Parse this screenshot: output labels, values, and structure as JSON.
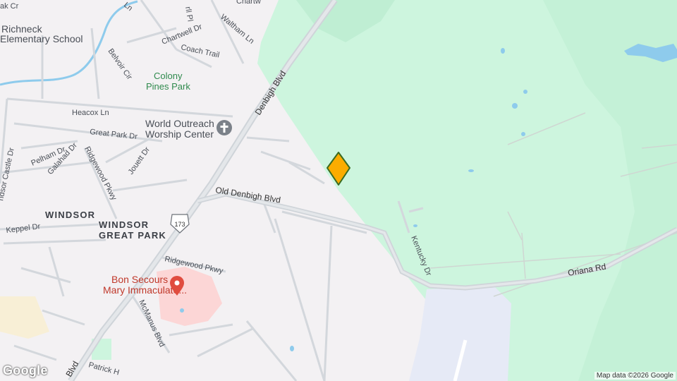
{
  "map": {
    "colors": {
      "land": "#f3f1f3",
      "park": "#cdf5de",
      "park_dark": "#bfeed3",
      "water": "#8ecbec",
      "road_major": "#cfd4d9",
      "road_minor": "#d6d9de",
      "hospital": "#fcd6d6",
      "airport": "#e6eaf6",
      "commercial": "#f8efd6",
      "marker": "#fbac00",
      "marker_stroke": "#3a6b22"
    },
    "labels": {
      "school": [
        "Richneck",
        "Elementary School"
      ],
      "colony_pines": [
        "Colony",
        "Pines Park"
      ],
      "church": [
        "World Outreach",
        "Worship Center"
      ],
      "windsor": "WINDSOR",
      "windsor_great_park": [
        "WINDSOR",
        "GREAT PARK"
      ],
      "hospital": [
        "Bon Secours",
        "Mary Immaculate..."
      ],
      "route_shield": "173"
    },
    "streets": {
      "chartwell_top": "Chartw",
      "waltham": "Waltham Ln",
      "chartwell_dr": "Chartwell Dr",
      "coach_trail": "Coach Trail",
      "belvoir": "Belvoir Cir",
      "denbigh": "Denbigh Blvd",
      "heacox": "Heacox Ln",
      "great_park": "Great Park Dr",
      "pelham": "Pelham Dr",
      "galahad": "Galahad Dr",
      "ridgewood_pkwy_v": "Ridgewood Pkwy",
      "jouett": "Jouett Dr",
      "castle": "ndsor Castle Dr",
      "old_denbigh": "Old Denbigh Blvd",
      "keppel": "Keppel Dr",
      "ridgewood_pkwy_h": "Ridgewood Pkwy",
      "mcmanus": "McManus Blvd",
      "kentucky": "Kentucky Dr",
      "oriana": "Oriana Rd",
      "patrick": "Patrick H",
      "blvd_bottom": "Blvd",
      "oak_top": "ak Cr",
      "pl_top": "rll Pl",
      "ln_top": "Ln"
    },
    "attribution": "Map data ©2026 Google",
    "logo": "Google"
  }
}
